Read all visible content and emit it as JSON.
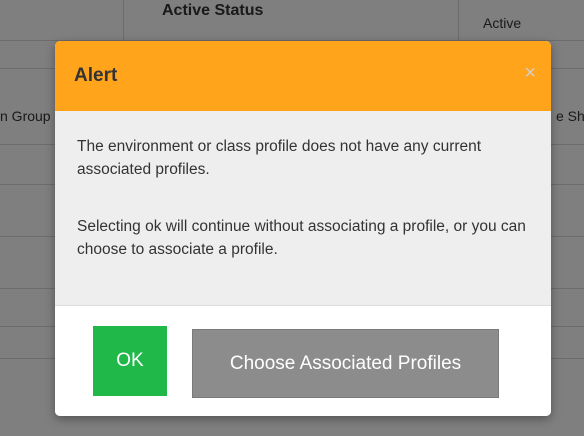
{
  "background": {
    "column_header": "Active Status",
    "active_cell": "Active",
    "left_header_fragment": "n Group",
    "right_header_fragment": "e Sh"
  },
  "modal": {
    "title": "Alert",
    "close_glyph": "×",
    "header_color": "#ffa41b",
    "body_paragraphs": [
      "The environment or class profile does not have any current associated profiles.",
      "Selecting ok will continue without associating a profile, or you can choose to associate a profile."
    ],
    "ok_label": "OK",
    "ok_color": "#21b84a",
    "choose_label": "Choose Associated Profiles",
    "choose_color": "#8c8c8c"
  }
}
